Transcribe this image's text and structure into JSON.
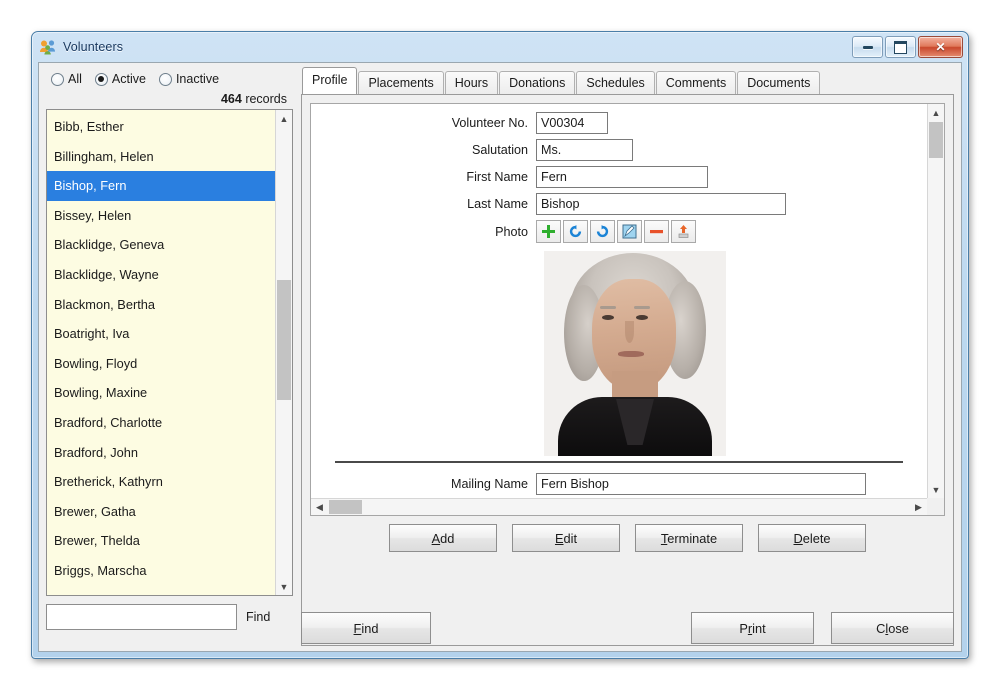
{
  "window": {
    "title": "Volunteers",
    "icon": "people-group-icon",
    "controls": {
      "minimize": "Minimize",
      "maximize": "Maximize",
      "close": "✕"
    }
  },
  "filter": {
    "options": [
      {
        "label": "All",
        "selected": false
      },
      {
        "label": "Active",
        "selected": true
      },
      {
        "label": "Inactive",
        "selected": false
      }
    ],
    "record_count": "464",
    "record_label": "records"
  },
  "list": {
    "items": [
      "Bibb, Esther",
      "Billingham, Helen",
      "Bishop, Fern",
      "Bissey, Helen",
      "Blacklidge, Geneva",
      "Blacklidge, Wayne",
      "Blackmon, Bertha",
      "Boatright, Iva",
      "Bowling, Floyd",
      "Bowling, Maxine",
      "Bradford, Charlotte",
      "Bradford, John",
      "Bretherick, Kathyrn",
      "Brewer, Gatha",
      "Brewer, Thelda",
      "Briggs, Marscha"
    ],
    "selected_index": 2
  },
  "find": {
    "value": "",
    "placeholder": "",
    "label": "Find"
  },
  "tabs": [
    {
      "label": "Profile",
      "active": true
    },
    {
      "label": "Placements",
      "active": false
    },
    {
      "label": "Hours",
      "active": false
    },
    {
      "label": "Donations",
      "active": false
    },
    {
      "label": "Schedules",
      "active": false
    },
    {
      "label": "Comments",
      "active": false
    },
    {
      "label": "Documents",
      "active": false
    }
  ],
  "profile": {
    "volunteer_no_label": "Volunteer No.",
    "volunteer_no_value": "V00304",
    "salutation_label": "Salutation",
    "salutation_value": "Ms.",
    "first_name_label": "First Name",
    "first_name_value": "Fern",
    "last_name_label": "Last Name",
    "last_name_value": "Bishop",
    "photo_label": "Photo",
    "mailing_name_label": "Mailing Name",
    "mailing_name_value": "Fern Bishop",
    "photo_tools": [
      {
        "name": "add-photo-icon",
        "title": "Add"
      },
      {
        "name": "rotate-left-icon",
        "title": "Rotate Left"
      },
      {
        "name": "rotate-right-icon",
        "title": "Rotate Right"
      },
      {
        "name": "edit-photo-icon",
        "title": "Edit"
      },
      {
        "name": "remove-photo-icon",
        "title": "Remove"
      },
      {
        "name": "export-photo-icon",
        "title": "Export"
      }
    ]
  },
  "actions": {
    "add": {
      "pre": "",
      "key": "A",
      "post": "dd"
    },
    "edit": {
      "pre": "",
      "key": "E",
      "post": "dit"
    },
    "terminate": {
      "pre": "",
      "key": "T",
      "post": "erminate"
    },
    "delete": {
      "pre": "",
      "key": "D",
      "post": "elete"
    },
    "find": {
      "pre": "",
      "key": "F",
      "post": "ind"
    },
    "print": {
      "pre": "P",
      "key": "r",
      "post": "int"
    },
    "close": {
      "pre": "C",
      "key": "l",
      "post": "ose"
    }
  },
  "colors": {
    "selection": "#2a7fe0",
    "list_bg": "#fdfce2",
    "titlebar": "#bcd8ef",
    "close_button": "#c9472c"
  }
}
